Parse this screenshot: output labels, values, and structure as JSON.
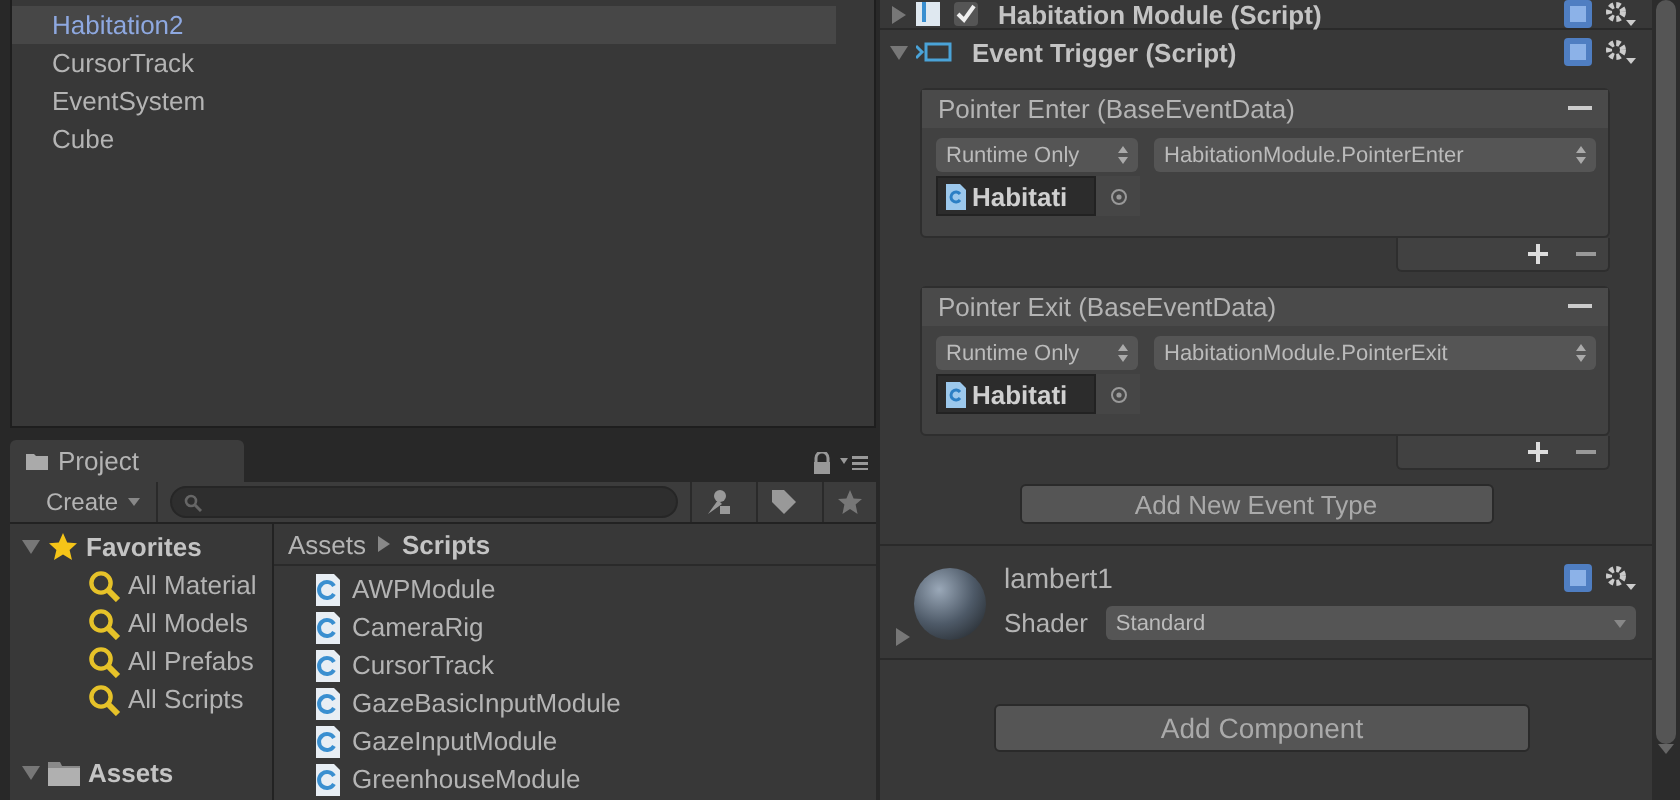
{
  "hierarchy": {
    "items": [
      {
        "label": "Habitation2",
        "selected": true
      },
      {
        "label": "CursorTrack",
        "selected": false
      },
      {
        "label": "EventSystem",
        "selected": false
      },
      {
        "label": "Cube",
        "selected": false
      }
    ]
  },
  "project": {
    "tab": "Project",
    "create": "Create",
    "favorites": {
      "label": "Favorites",
      "expanded": true,
      "items": [
        "All Material",
        "All Models",
        "All Prefabs",
        "All Scripts"
      ]
    },
    "assets": {
      "label": "Assets",
      "expanded": true
    },
    "breadcrumb": [
      "Assets",
      "Scripts"
    ],
    "files": [
      "AWPModule",
      "CameraRig",
      "CursorTrack",
      "GazeBasicInputModule",
      "GazeInputModule",
      "GreenhouseModule"
    ]
  },
  "inspector": {
    "components": [
      {
        "title": "Habitation Module (Script)",
        "expanded": false,
        "enabled": true
      },
      {
        "title": "Event Trigger (Script)",
        "expanded": true
      }
    ],
    "events": [
      {
        "title": "Pointer Enter (BaseEventData)",
        "mode": "Runtime Only",
        "function": "HabitationModule.PointerEnter",
        "object": "Habitati"
      },
      {
        "title": "Pointer Exit (BaseEventData)",
        "mode": "Runtime Only",
        "function": "HabitationModule.PointerExit",
        "object": "Habitati"
      }
    ],
    "add_event_button": "Add New Event Type",
    "material": {
      "name": "lambert1",
      "expanded": false,
      "shader_label": "Shader",
      "shader": "Standard"
    },
    "add_component_button": "Add Component"
  }
}
